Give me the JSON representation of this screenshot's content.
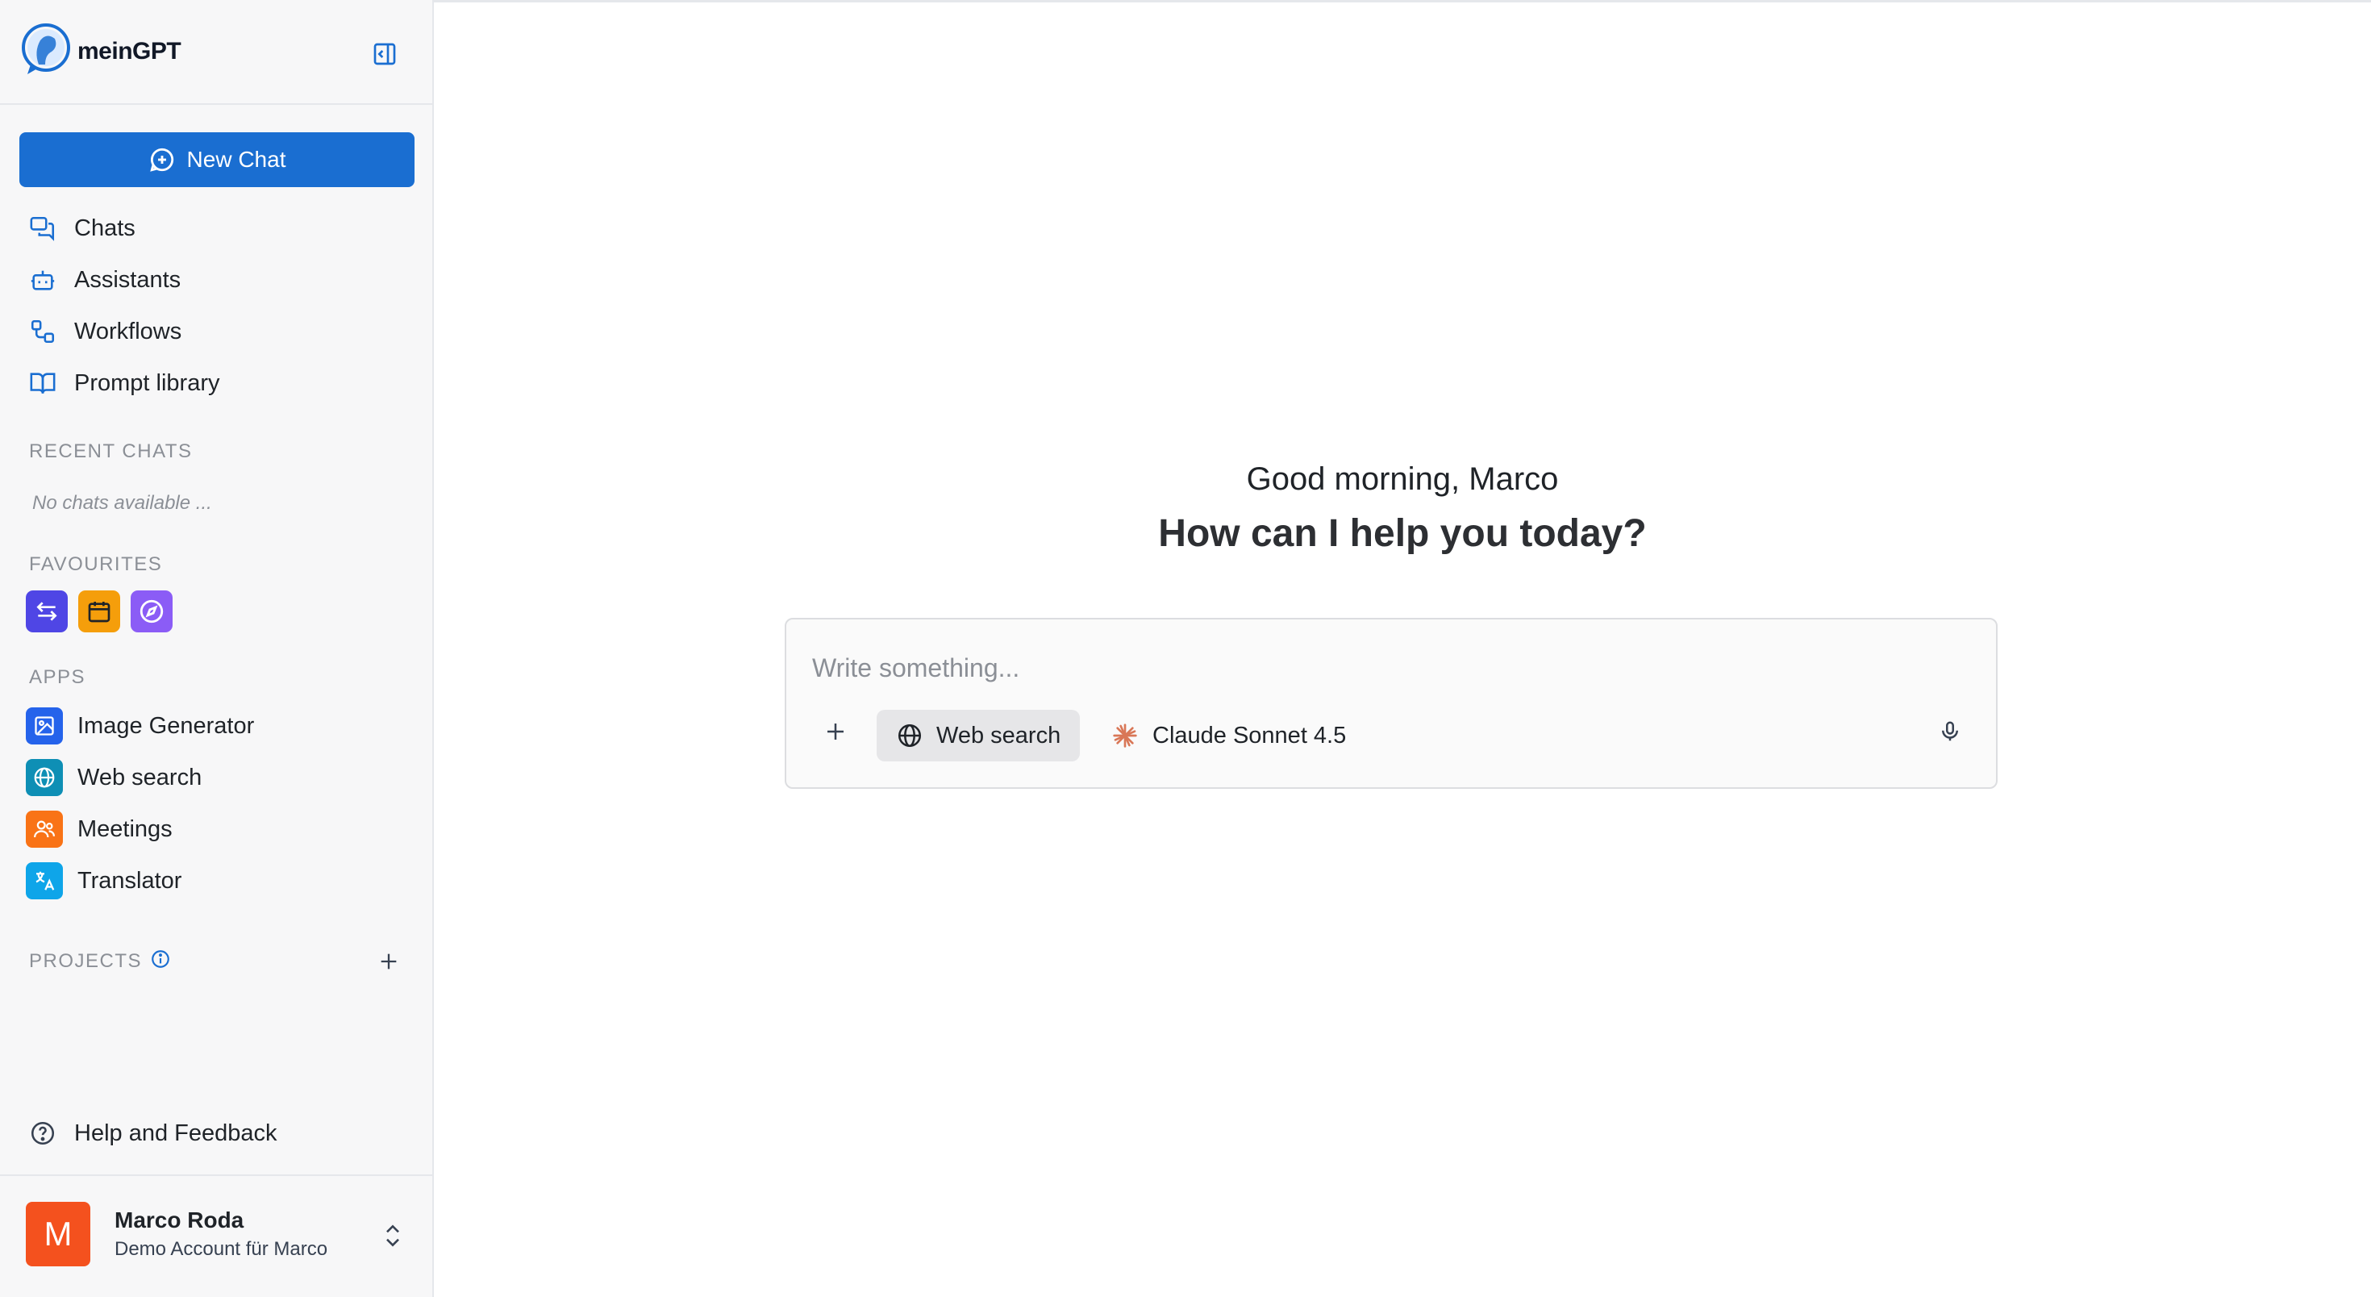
{
  "app": {
    "name": "meinGPT"
  },
  "sidebar": {
    "new_chat_label": "New Chat",
    "nav": [
      {
        "label": "Chats",
        "icon": "chats-icon"
      },
      {
        "label": "Assistants",
        "icon": "robot-icon"
      },
      {
        "label": "Workflows",
        "icon": "workflow-icon"
      },
      {
        "label": "Prompt library",
        "icon": "book-icon"
      }
    ],
    "recent_chats_label": "RECENT CHATS",
    "no_chats_text": "No chats available ...",
    "favourites_label": "FAVOURITES",
    "favourites": [
      {
        "icon": "arrows-exchange-icon",
        "color": "#4f46e5"
      },
      {
        "icon": "calendar-icon",
        "color": "#f59e0b"
      },
      {
        "icon": "compass-icon",
        "color": "#8b5cf6"
      }
    ],
    "apps_label": "APPS",
    "apps": [
      {
        "label": "Image Generator",
        "icon": "image-icon",
        "color": "#2563eb"
      },
      {
        "label": "Web search",
        "icon": "globe-icon",
        "color": "#0e8fb5"
      },
      {
        "label": "Meetings",
        "icon": "people-icon",
        "color": "#f97316"
      },
      {
        "label": "Translator",
        "icon": "translate-icon",
        "color": "#0ea5e9"
      }
    ],
    "projects_label": "PROJECTS",
    "help_label": "Help and Feedback",
    "user": {
      "initial": "M",
      "name": "Marco Roda",
      "account": "Demo Account für Marco",
      "avatar_color": "#f4511e"
    }
  },
  "main": {
    "greeting": "Good morning, Marco",
    "headline": "How can I help you today?",
    "composer": {
      "placeholder": "Write something...",
      "web_search_label": "Web search",
      "model_label": "Claude Sonnet 4.5"
    }
  },
  "colors": {
    "accent": "#1a6ed1",
    "model_icon": "#d97757"
  }
}
